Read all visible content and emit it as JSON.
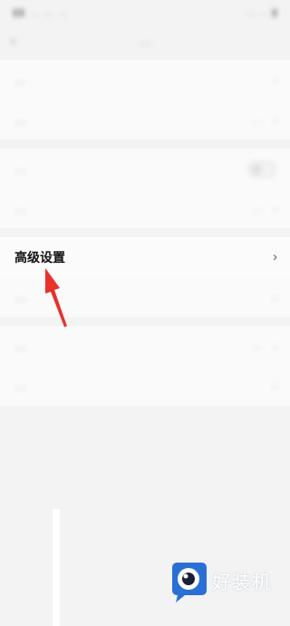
{
  "status_bar": {
    "left_text": "▮▮ … … …",
    "right_text": "… … ▮"
  },
  "nav": {
    "title": "…"
  },
  "groups": [
    {
      "rows": [
        {
          "label": "…",
          "value": "",
          "control": "chevron",
          "blurred": true
        },
        {
          "label": "…",
          "value": "…",
          "control": "chevron",
          "blurred": true
        }
      ]
    },
    {
      "rows": [
        {
          "label": "…",
          "value": "",
          "control": "toggle",
          "blurred": true
        },
        {
          "label": "…",
          "value": "…",
          "control": "chevron",
          "blurred": true
        }
      ]
    },
    {
      "rows": [
        {
          "label": "高级设置",
          "value": "",
          "control": "chevron",
          "blurred": false
        },
        {
          "label": "…",
          "value": "",
          "control": "chevron",
          "blurred": true
        }
      ]
    },
    {
      "rows": [
        {
          "label": "…",
          "value": "…",
          "control": "chevron",
          "blurred": true
        },
        {
          "label": "…",
          "value": "",
          "control": "chevron",
          "blurred": true
        }
      ]
    }
  ],
  "highlighted": {
    "label": "高级设置",
    "chevron": "›"
  },
  "glyphs": {
    "chevron": "›",
    "back": "‹"
  },
  "annotation": {
    "color": "#e8322a"
  },
  "watermark": {
    "text": "好装机",
    "logo_color": "#2a6fd6"
  }
}
